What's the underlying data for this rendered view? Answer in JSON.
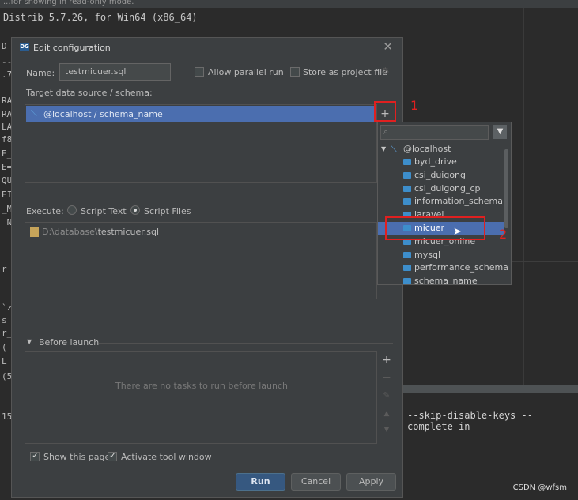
{
  "background": {
    "top_text": "...for showing in read-only mode.",
    "distrib": "Distrib 5.7.26, for Win64 (x86_64)",
    "left_letters": [
      "D",
      "--",
      ".7",
      "RA",
      "RA",
      "LA",
      "f8",
      "E_",
      "E=",
      "QU",
      "EI",
      "_M",
      "_N",
      "r",
      "`z",
      "s_",
      "r_",
      "(",
      "L",
      "(5",
      "15"
    ],
    "right_command": "--skip-disable-keys --complete-in"
  },
  "watermark": "CSDN @wfsm",
  "dialog": {
    "title": "Edit configuration",
    "name_label": "Name:",
    "name_value": "testmicuer.sql",
    "allow_parallel": "Allow parallel run",
    "store_project": "Store as project file",
    "target_label": "Target data source / schema:",
    "data_source": "@localhost / schema_name",
    "execute_label": "Execute:",
    "script_text": "Script Text",
    "script_files": "Script Files",
    "file_path_prefix": "D:\\database\\",
    "file_path_name": "testmicuer.sql",
    "before_launch": "Before launch",
    "no_tasks": "There are no tasks to run before launch",
    "show_page": "Show this page",
    "activate_tool": "Activate tool window",
    "run": "Run",
    "cancel": "Cancel",
    "apply": "Apply"
  },
  "popup": {
    "root": "@localhost",
    "schemas": [
      "byd_drive",
      "csi_duigong",
      "csi_duigong_cp",
      "information_schema",
      "laravel",
      "micuer",
      "micuer_online",
      "mysql",
      "performance_schema",
      "schema_name"
    ],
    "selected": "micuer"
  },
  "annotations": {
    "one": "1",
    "two": "2"
  }
}
